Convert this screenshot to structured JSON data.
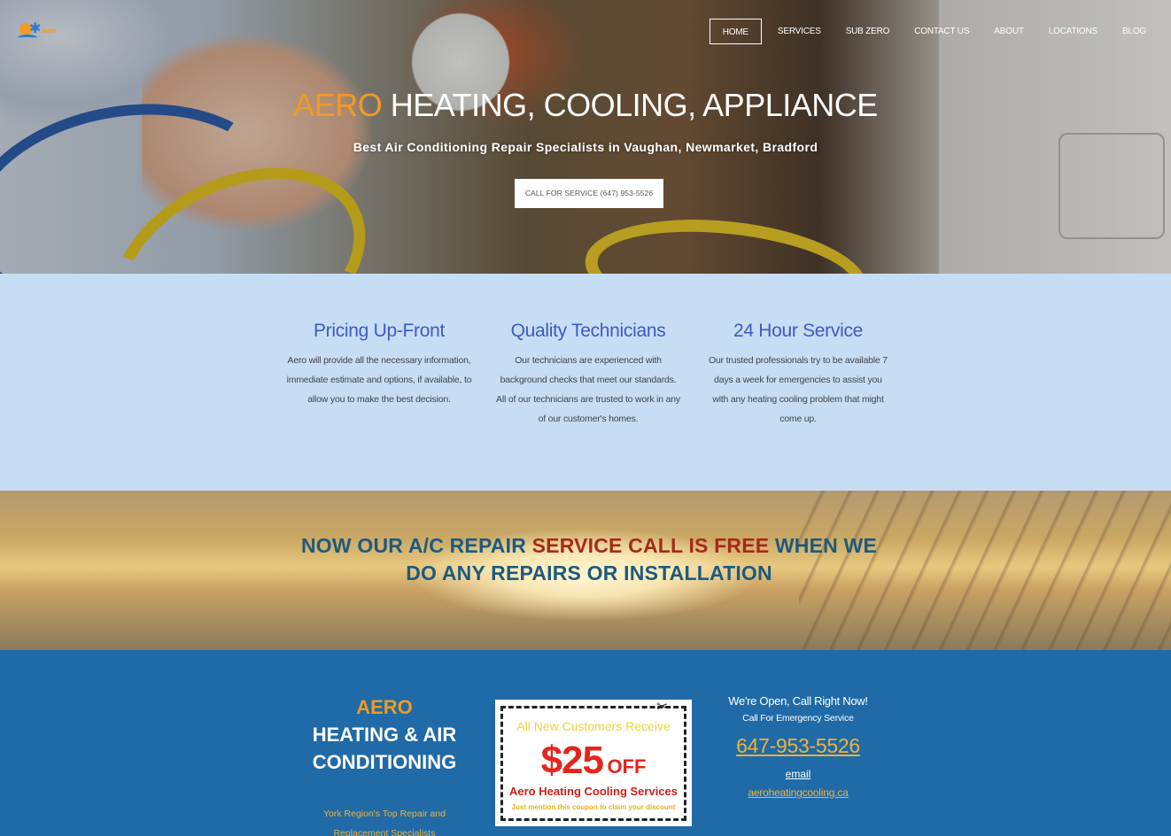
{
  "logo": {
    "text": "aero"
  },
  "nav": {
    "items": [
      {
        "label": "HOME"
      },
      {
        "label": "SERVICES"
      },
      {
        "label": "SUB ZERO"
      },
      {
        "label": "CONTACT US"
      },
      {
        "label": "ABOUT"
      },
      {
        "label": "LOCATIONS"
      },
      {
        "label": "BLOG"
      }
    ],
    "active": "HOME"
  },
  "hero": {
    "title_brand": "AERO",
    "title_rest": "HEATING, COOLING, APPLIANCE",
    "subtitle": "Best Air Conditioning Repair Specialists in Vaughan, Newmarket, Bradford",
    "button_label": "CALL FOR SERVICE (647) 953-5526"
  },
  "features": [
    {
      "title": "Pricing Up-Front",
      "text": "Aero will provide all the necessary information, immediate estimate and options, if available, to allow you to make the best decision."
    },
    {
      "title": "Quality Technicians",
      "text": "Our technicians are experienced with background checks that meet our standards.  All of our technicians are trusted to work in any of our customer's homes."
    },
    {
      "title": "24 Hour Service",
      "text": "Our trusted professionals try to be available 7 days a week for emergencies to assist you with any heating cooling problem that might come up."
    }
  ],
  "promo": {
    "part1": "NOW OUR A/C REPAIR ",
    "highlight": "SERVICE CALL IS FREE",
    "part2": " WHEN WE DO ANY REPAIRS OR INSTALLATION"
  },
  "footer": {
    "brand_line1": "AERO",
    "brand_line2": "HEATING & AIR CONDITIONING",
    "tagline": "York Region's Top Repair and Replacement Specialists",
    "coupon": {
      "line1": "All New Customers Receive",
      "amount": "$25",
      "off": "OFF",
      "company": "Aero Heating Cooling Services",
      "note": "Just mention this coupon to claim your discount"
    },
    "open_text": "We're Open, Call Right Now!",
    "emergency_text": "Call For Emergency Service",
    "phone": "647-953-5526",
    "email_label": "email",
    "website": "aeroheatingcooling.ca"
  },
  "colors": {
    "accent_orange": "#f29a22",
    "feature_blue": "#3d5bc2",
    "features_bg": "#c6ddf4",
    "footer_bg": "#1f6aa7",
    "promo_red": "#a52a1c",
    "promo_blue": "#1d5a7e"
  },
  "icons": {
    "logo": "aero-logo-icon",
    "coupon_cut": "scissors-icon"
  }
}
